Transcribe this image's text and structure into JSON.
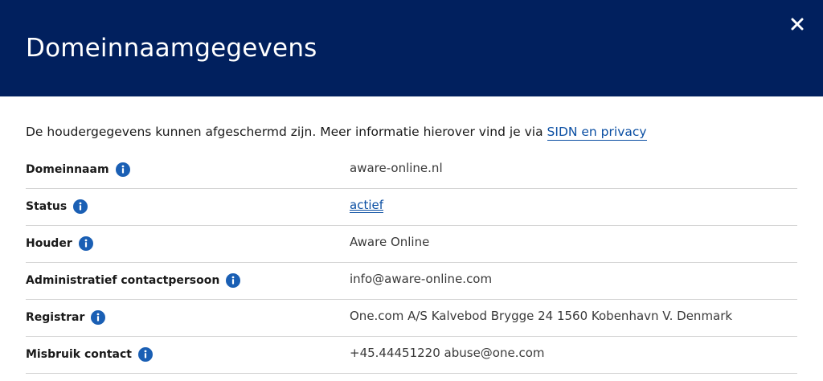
{
  "dialog": {
    "title": "Domeinnaamgegevens",
    "close_icon": "close-icon"
  },
  "intro": {
    "text": "De houdergegevens kunnen afgeschermd zijn. Meer informatie hierover vind je via ",
    "link_label": "SIDN en privacy"
  },
  "rows": [
    {
      "label": "Domeinnaam",
      "value": "aware-online.nl",
      "is_link": false
    },
    {
      "label": "Status",
      "value": "actief",
      "is_link": true
    },
    {
      "label": "Houder",
      "value": "Aware Online",
      "is_link": false
    },
    {
      "label": "Administratief contactpersoon",
      "value": "info@aware-online.com",
      "is_link": false
    },
    {
      "label": "Registrar",
      "value": "One.com A/S Kalvebod Brygge 24 1560 Kobenhavn V. Denmark",
      "is_link": false
    },
    {
      "label": "Misbruik contact",
      "value": "+45.44451220 abuse@one.com",
      "is_link": false
    }
  ],
  "colors": {
    "header_bg": "#01205e",
    "link": "#0b4fa3",
    "info_icon": "#1a5fb4"
  },
  "icons": {
    "info": "info-icon"
  }
}
